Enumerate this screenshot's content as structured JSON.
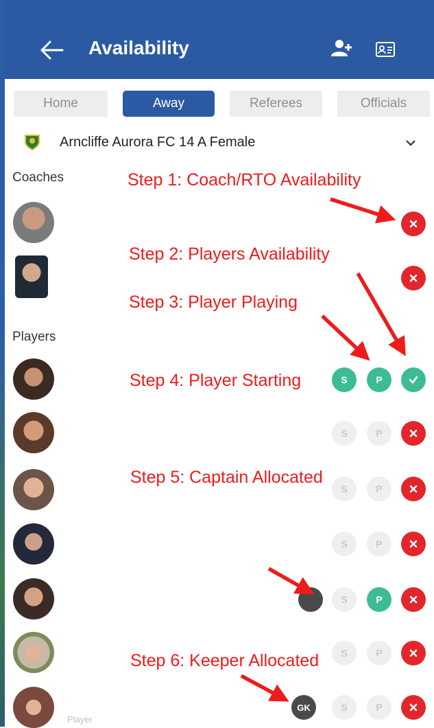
{
  "header": {
    "title": "Availability",
    "icons": [
      "back-arrow-icon",
      "add-person-icon",
      "id-card-icon"
    ]
  },
  "tabs": [
    {
      "label": "Home",
      "active": false
    },
    {
      "label": "Away",
      "active": true
    },
    {
      "label": "Referees",
      "active": false
    },
    {
      "label": "Officials",
      "active": false
    }
  ],
  "team_selector": {
    "name": "Arncliffe Aurora FC 14 A Female"
  },
  "sections": {
    "coaches": "Coaches",
    "players": "Players"
  },
  "buttons": {
    "starting": "S",
    "playing": "P",
    "keeper": "GK"
  },
  "player_ghost_label": "Player",
  "annotations": {
    "step1": "Step 1: Coach/RTO Availability",
    "step2": "Step 2: Players Availability",
    "step3": "Step 3: Player Playing",
    "step4": "Step 4: Player Starting",
    "step5": "Step 5: Captain Allocated",
    "step6": "Step 6: Keeper Allocated"
  },
  "colors": {
    "header": "#2b5aa2",
    "unavailable": "#e2262b",
    "selected": "#3dbb95",
    "inactive": "#efefef",
    "annotation": "#ee1b1b"
  }
}
